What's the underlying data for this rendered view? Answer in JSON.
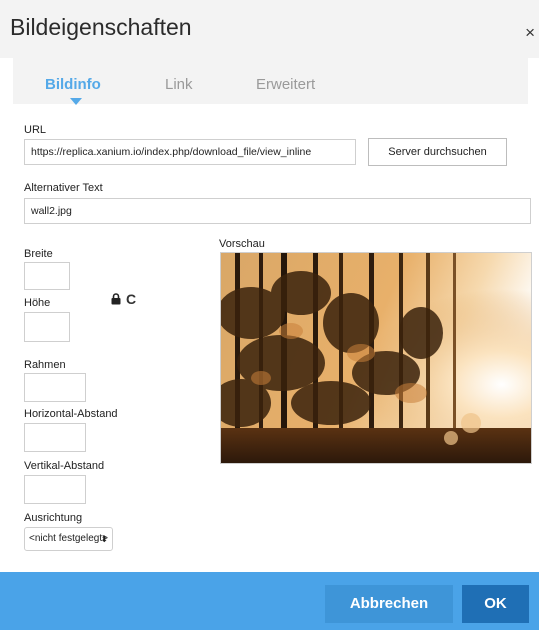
{
  "dialog": {
    "title": "Bildeigenschaften",
    "close_glyph": "×"
  },
  "tabs": [
    {
      "label": "Bildinfo",
      "active": true
    },
    {
      "label": "Link",
      "active": false
    },
    {
      "label": "Erweitert",
      "active": false
    }
  ],
  "form": {
    "url_label": "URL",
    "url_value": "https://replica.xanium.io/index.php/download_file/view_inline",
    "browse_button": "Server durchsuchen",
    "alt_label": "Alternativer Text",
    "alt_value": "wall2.jpg",
    "width_label": "Breite",
    "height_label": "Höhe",
    "border_label": "Rahmen",
    "hspace_label": "Horizontal-Abstand",
    "vspace_label": "Vertikal-Abstand",
    "align_label": "Ausrichtung",
    "align_value": "<nicht festgelegt>",
    "preview_label": "Vorschau"
  },
  "icons": {
    "lock": "lock-icon",
    "reset": "reset-icon",
    "reset_glyph": "C"
  },
  "footer": {
    "cancel_label": "Abbrechen",
    "ok_label": "OK"
  },
  "colors": {
    "accent": "#55a9e8",
    "footer": "#4aa3e8",
    "ok_button": "#1f6fb5",
    "cancel_button": "#3e95d8"
  }
}
